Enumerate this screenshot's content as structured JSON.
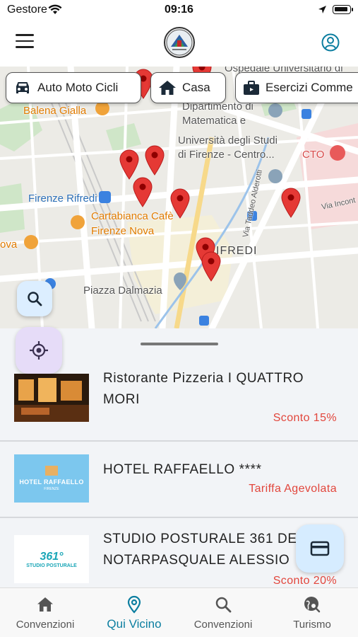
{
  "status_bar": {
    "carrier": "Gestore",
    "time": "09:16"
  },
  "header": {
    "menu_icon": "hamburger-menu-icon",
    "logo": "association-logo",
    "profile_icon": "user-circle-icon"
  },
  "map": {
    "labels": {
      "hospital": "Ospedale Universitario di",
      "balena": "Balena Gialla",
      "dipartimento1": "Dipartimento di",
      "dipartimento2": "Matematica e",
      "universita1": "Università degli Studi",
      "universita2": "di Firenze - Centro...",
      "cto": "CTO",
      "rifredi_station": "Firenze Rifredi",
      "cartabianca1": "Cartabianca Cafè",
      "cartabianca2": "Firenze Nova",
      "nova": "ova",
      "rifredi": "IFREDI",
      "piazza": "Piazza Dalmazia",
      "via_alderotti": "Via Taddeo Alderotti",
      "via_incontri": "Via Incont"
    },
    "filter_chips": [
      {
        "label": "Auto Moto Cicli",
        "icon": "car-icon"
      },
      {
        "label": "Casa",
        "icon": "house-icon"
      },
      {
        "label": "Esercizi Comme",
        "icon": "briefcase-icon"
      }
    ],
    "marker_color": "#e53935"
  },
  "fabs": {
    "search_icon": "search-icon",
    "locate_icon": "gps-locate-icon",
    "card_icon": "credit-card-icon"
  },
  "listings": [
    {
      "name": "Ristorante Pizzeria I QUATTRO MORI",
      "discount": "Sconto 15%"
    },
    {
      "name": "HOTEL RAFFAELLO ****",
      "discount": "Tariffa Agevolata",
      "thumb_text": "HOTEL RAFFAELLO",
      "thumb_sub": "FIRENZE"
    },
    {
      "name": "STUDIO POSTURALE 361 DEL NOTARPASQUALE ALESSIO",
      "discount": "Sconto 20%",
      "thumb_text": "361°",
      "thumb_sub": "STUDIO POSTURALE"
    }
  ],
  "tabs": [
    {
      "label": "Convenzioni",
      "icon": "home-icon",
      "active": false
    },
    {
      "label": "Qui Vicino",
      "icon": "map-pin-icon",
      "active": true
    },
    {
      "label": "Convenzioni",
      "icon": "search-icon",
      "active": false
    },
    {
      "label": "Turismo",
      "icon": "globe-search-icon",
      "active": false
    }
  ],
  "colors": {
    "accent": "#0c7ea0",
    "discount": "#e2463c",
    "marker": "#e53935"
  }
}
